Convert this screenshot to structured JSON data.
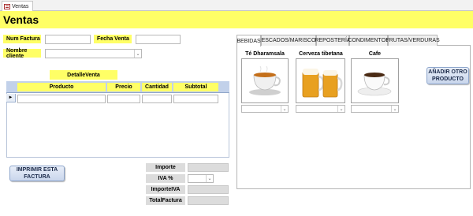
{
  "doc_tab": {
    "label": "Ventas"
  },
  "header": {
    "title": "Ventas"
  },
  "form": {
    "num_factura_label": "Num Factura",
    "num_factura_value": "",
    "fecha_venta_label": "Fecha Venta",
    "fecha_venta_value": "",
    "nombre_cliente_label": "Nombre cliente",
    "nombre_cliente_value": ""
  },
  "detalle": {
    "title": "DetalleVenta",
    "columns": [
      "Producto",
      "Precio",
      "Cantidad",
      "Subtotal"
    ],
    "rows": [
      {
        "producto": "",
        "precio": "",
        "cantidad": "",
        "subtotal": ""
      }
    ],
    "row_selector": "►"
  },
  "totals": {
    "importe_label": "Importe",
    "importe_value": "",
    "iva_label": "IVA %",
    "iva_value": "",
    "importe_iva_label": "ImporteIVA",
    "importe_iva_value": "",
    "total_label": "TotalFactura",
    "total_value": ""
  },
  "buttons": {
    "print": "IMPRIMIR ESTA FACTURA",
    "add_product": "AÑADIR OTRO PRODUCTO"
  },
  "tabs": [
    {
      "label": "BEBIDAS",
      "active": true
    },
    {
      "label": "PESCADOS/MARISCOS",
      "active": false
    },
    {
      "label": "REPOSTERÍA",
      "active": false
    },
    {
      "label": "CONDIMENTOS",
      "active": false
    },
    {
      "label": "FRUTAS/VERDURAS",
      "active": false
    }
  ],
  "products": [
    {
      "name": "Té Dharamsala",
      "icon": "tea-cup-icon",
      "qty_value": ""
    },
    {
      "name": "Cerveza tibetana",
      "icon": "beer-mugs-icon",
      "qty_value": ""
    },
    {
      "name": "Cafe",
      "icon": "coffee-cup-icon",
      "qty_value": ""
    }
  ],
  "icons": {
    "dropdown": "chevron-down-icon",
    "form_tab": "form-icon"
  },
  "colors": {
    "label_yellow": "#ffff66",
    "subform_header": "#c2d1ea",
    "button_blue": "#c9d6ec"
  }
}
